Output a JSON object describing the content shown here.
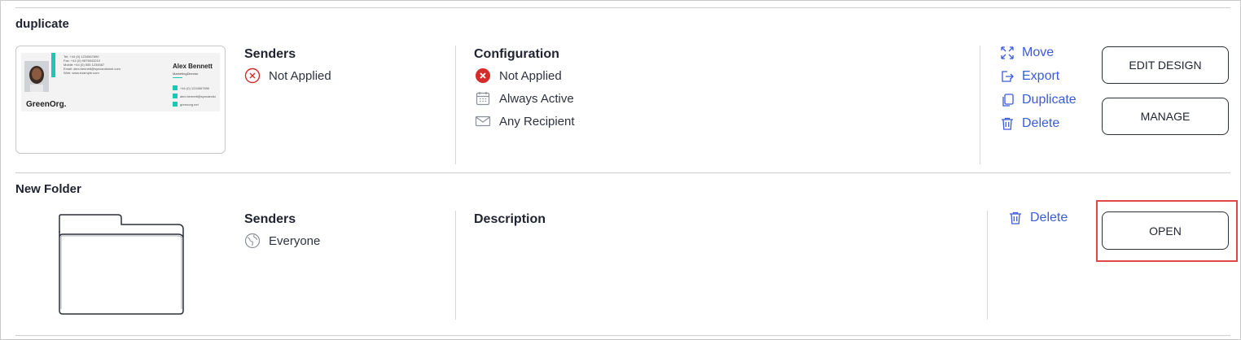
{
  "items": [
    {
      "title": "duplicate",
      "senders_label": "Senders",
      "senders_value": "Not Applied",
      "config_label": "Configuration",
      "config_rows": [
        "Not Applied",
        "Always Active",
        "Any Recipient"
      ],
      "actions": [
        "Move",
        "Export",
        "Duplicate",
        "Delete"
      ],
      "buttons": [
        "EDIT DESIGN",
        "MANAGE"
      ],
      "preview": {
        "name": "Alex Bennett",
        "role": "MarketingDirector",
        "brand": "GreenOrg.",
        "contact_lines": [
          "Tel:  +44 (0) 1234567890",
          "Fax:  +44 (0) 9876543210",
          "Mobile +44 (0) 555 1234567",
          "Email: alex.bennett@syncandsinel.com",
          "Web:  www.example.com"
        ],
        "contact_icons": [
          "+44 (0) 1234567890",
          "alex.bennett@syncandsi",
          "greenorg.net"
        ]
      }
    },
    {
      "title": "New Folder",
      "senders_label": "Senders",
      "senders_value": "Everyone",
      "desc_label": "Description",
      "actions": [
        "Delete"
      ],
      "buttons": [
        "OPEN"
      ]
    }
  ],
  "colors": {
    "accent": "#3b5bd6",
    "error": "#d42b2b",
    "highlight": "#e04848",
    "teal": "#1fc6b4"
  }
}
